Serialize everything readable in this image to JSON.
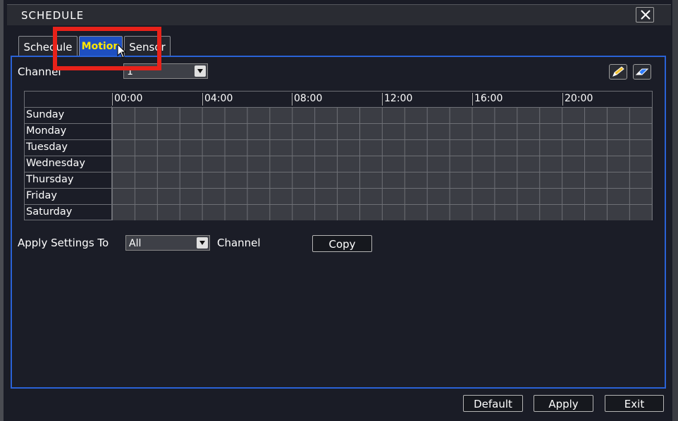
{
  "window": {
    "title": "SCHEDULE"
  },
  "tabs": [
    {
      "label": "Schedule",
      "active": false
    },
    {
      "label": "Motion",
      "active": true
    },
    {
      "label": "Sensor",
      "active": false
    }
  ],
  "channel": {
    "label": "Channel",
    "value": "1"
  },
  "schedule_grid": {
    "hours": [
      "00:00",
      "04:00",
      "08:00",
      "12:00",
      "16:00",
      "20:00"
    ],
    "days": [
      "Sunday",
      "Monday",
      "Tuesday",
      "Wednesday",
      "Thursday",
      "Friday",
      "Saturday"
    ]
  },
  "apply_settings": {
    "label": "Apply Settings To",
    "value": "All",
    "suffix": "Channel"
  },
  "buttons": {
    "copy": "Copy",
    "default": "Default",
    "apply": "Apply",
    "exit": "Exit"
  },
  "colors": {
    "active_tab": "#1e4fc0",
    "active_tab_text": "#ffe600",
    "panel_border": "#2a62d6",
    "highlight_box": "#e8221a",
    "grid_cell": "#3b3d44"
  },
  "icons": [
    "close-icon",
    "pencil-icon",
    "eraser-icon",
    "mouse-cursor-icon",
    "chevron-down-icon"
  ]
}
